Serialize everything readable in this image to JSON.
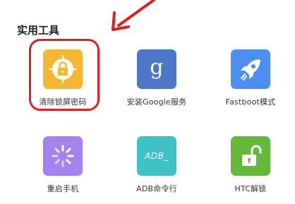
{
  "section": {
    "title": "实用工具"
  },
  "tools": [
    {
      "label": "清除锁屏密码",
      "icon": "lock-circle-icon",
      "color": "#f5b731",
      "highlighted": true
    },
    {
      "label": "安装Google服务",
      "icon": "google-g-icon",
      "color": "#4d78c8",
      "glyph": "g"
    },
    {
      "label": "Fastboot模式",
      "icon": "rocket-icon",
      "color": "#4d8ff0"
    },
    {
      "label": "重启手机",
      "icon": "loading-spinner-icon",
      "color": "#a583ee"
    },
    {
      "label": "ADB命令行",
      "icon": "adb-terminal-icon",
      "color": "#3ec2c6",
      "glyph": "ADB_"
    },
    {
      "label": "HTC解锁",
      "icon": "unlocked-padlock-icon",
      "color": "#66b83a"
    }
  ],
  "annotation": {
    "color": "#e02020"
  }
}
